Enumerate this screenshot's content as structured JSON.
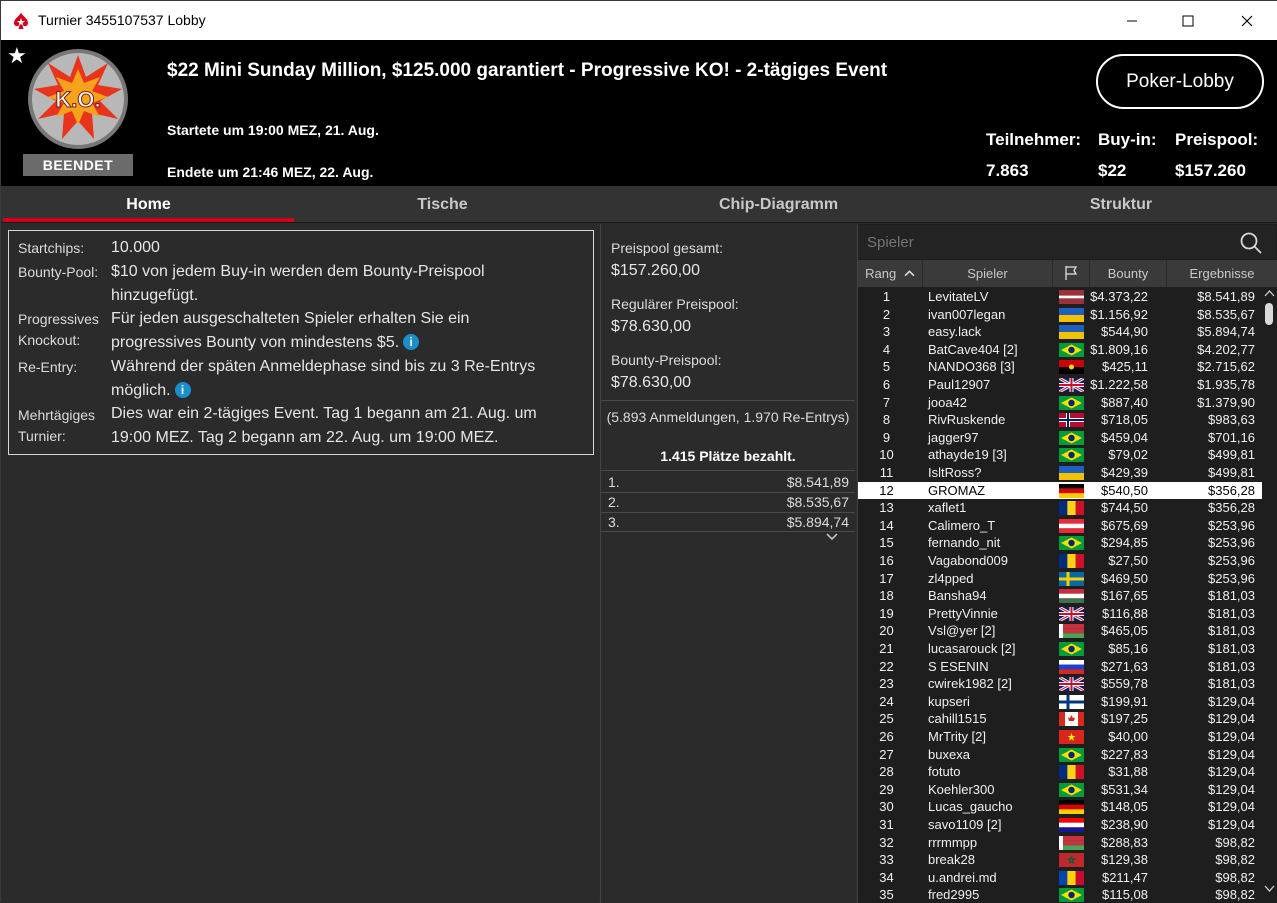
{
  "window": {
    "title": "Turnier 3455107537 Lobby"
  },
  "header": {
    "status": "BEENDET",
    "event_title": "$22 Mini Sunday Million, $125.000 garantiert - Progressive KO! - 2-tägiges Event",
    "started": "Startete um 19:00 MEZ, 21. Aug.",
    "ended": "Endete um 21:46 MEZ, 22. Aug.",
    "lobby_button": "Poker-Lobby",
    "logo_text": "K.O.",
    "stats": [
      {
        "label": "Teilnehmer:",
        "value": "7.863"
      },
      {
        "label": "Buy-in:",
        "value": "$22"
      },
      {
        "label": "Preispool:",
        "value": "$157.260"
      }
    ]
  },
  "tabs": [
    {
      "label": "Home",
      "active": true
    },
    {
      "label": "Tische",
      "active": false
    },
    {
      "label": "Chip-Diagramm",
      "active": false
    },
    {
      "label": "Struktur",
      "active": false
    }
  ],
  "info": [
    {
      "label": "Startchips:",
      "value": "10.000"
    },
    {
      "label": "Bounty-Pool:",
      "value": "$10 von jedem Buy-in werden dem Bounty-Preispool hinzugefügt."
    },
    {
      "label": "Progressives Knockout:",
      "value": "Für jeden ausgeschalteten Spieler erhalten Sie ein progressives Bounty von mindestens $5."
    },
    {
      "label": "Re-Entry:",
      "value": "Während der späten Anmeldephase sind bis zu 3 Re-Entrys möglich."
    },
    {
      "label": "Mehrtägiges Turnier:",
      "value": "Dies war ein 2-tägiges Event. Tag 1 begann am 21. Aug. um 19:00 MEZ. Tag 2 begann am 22. Aug. um 19:00 MEZ."
    }
  ],
  "prizepool": {
    "total_label": "Preispool gesamt:",
    "total": "$157.260,00",
    "regular_label": "Regulärer Preispool:",
    "regular": "$78.630,00",
    "bounty_label": "Bounty-Preispool:",
    "bounty": "$78.630,00",
    "registrations": "(5.893 Anmeldungen, 1.970 Re-Entrys)",
    "paid": "1.415 Plätze bezahlt.",
    "payouts": [
      {
        "rank": "1.",
        "amount": "$8.541,89"
      },
      {
        "rank": "2.",
        "amount": "$8.535,67"
      },
      {
        "rank": "3.",
        "amount": "$5.894,74"
      }
    ]
  },
  "players": {
    "search_placeholder": "Spieler",
    "columns": {
      "rank": "Rang",
      "player": "Spieler",
      "bounty": "Bounty",
      "result": "Ergebnisse"
    },
    "highlighted_rank": "12",
    "rows": [
      {
        "rank": "1",
        "name": "LevitateLV",
        "flag": "lv",
        "bounty": "$4.373,22",
        "result": "$8.541,89"
      },
      {
        "rank": "2",
        "name": "ivan007legan",
        "flag": "ua",
        "bounty": "$1.156,92",
        "result": "$8.535,67"
      },
      {
        "rank": "3",
        "name": "easy.lack",
        "flag": "ua",
        "bounty": "$544,90",
        "result": "$5.894,74"
      },
      {
        "rank": "4",
        "name": "BatCave404 [2]",
        "flag": "br",
        "bounty": "$1.809,16",
        "result": "$4.202,77"
      },
      {
        "rank": "5",
        "name": "NANDO368 [3]",
        "flag": "ao",
        "bounty": "$425,11",
        "result": "$2.715,62"
      },
      {
        "rank": "6",
        "name": "Paul12907",
        "flag": "gb",
        "bounty": "$1.222,58",
        "result": "$1.935,78"
      },
      {
        "rank": "7",
        "name": "jooa42",
        "flag": "br",
        "bounty": "$887,40",
        "result": "$1.379,90"
      },
      {
        "rank": "8",
        "name": "RivRuskende",
        "flag": "no",
        "bounty": "$718,05",
        "result": "$983,63"
      },
      {
        "rank": "9",
        "name": "jagger97",
        "flag": "br",
        "bounty": "$459,04",
        "result": "$701,16"
      },
      {
        "rank": "10",
        "name": "athayde19 [3]",
        "flag": "br",
        "bounty": "$79,02",
        "result": "$499,81"
      },
      {
        "rank": "11",
        "name": "IsltRoss?",
        "flag": "ua",
        "bounty": "$429,39",
        "result": "$499,81"
      },
      {
        "rank": "12",
        "name": "GROMAZ",
        "flag": "de",
        "bounty": "$540,50",
        "result": "$356,28"
      },
      {
        "rank": "13",
        "name": "xaflet1",
        "flag": "ro",
        "bounty": "$744,50",
        "result": "$356,28"
      },
      {
        "rank": "14",
        "name": "Calimero_T",
        "flag": "at",
        "bounty": "$675,69",
        "result": "$253,96"
      },
      {
        "rank": "15",
        "name": "fernando_nit",
        "flag": "br",
        "bounty": "$294,85",
        "result": "$253,96"
      },
      {
        "rank": "16",
        "name": "Vagabond009",
        "flag": "ro",
        "bounty": "$27,50",
        "result": "$253,96"
      },
      {
        "rank": "17",
        "name": "zl4pped",
        "flag": "se",
        "bounty": "$469,50",
        "result": "$253,96"
      },
      {
        "rank": "18",
        "name": "Bansha94",
        "flag": "hu",
        "bounty": "$167,65",
        "result": "$181,03"
      },
      {
        "rank": "19",
        "name": "PrettyVinnie",
        "flag": "gb",
        "bounty": "$116,88",
        "result": "$181,03"
      },
      {
        "rank": "20",
        "name": "Vsl@yer [2]",
        "flag": "by",
        "bounty": "$465,05",
        "result": "$181,03"
      },
      {
        "rank": "21",
        "name": "lucasarouck [2]",
        "flag": "br",
        "bounty": "$85,16",
        "result": "$181,03"
      },
      {
        "rank": "22",
        "name": "S ESENIN",
        "flag": "ru",
        "bounty": "$271,63",
        "result": "$181,03"
      },
      {
        "rank": "23",
        "name": "cwirek1982 [2]",
        "flag": "gb",
        "bounty": "$559,78",
        "result": "$181,03"
      },
      {
        "rank": "24",
        "name": "kupseri",
        "flag": "fi",
        "bounty": "$199,91",
        "result": "$129,04"
      },
      {
        "rank": "25",
        "name": "cahill1515",
        "flag": "ca",
        "bounty": "$197,25",
        "result": "$129,04"
      },
      {
        "rank": "26",
        "name": "MrTrity [2]",
        "flag": "vn",
        "bounty": "$40,00",
        "result": "$129,04"
      },
      {
        "rank": "27",
        "name": "buxexa",
        "flag": "br",
        "bounty": "$227,83",
        "result": "$129,04"
      },
      {
        "rank": "28",
        "name": "fotuto",
        "flag": "ro",
        "bounty": "$31,88",
        "result": "$129,04"
      },
      {
        "rank": "29",
        "name": "Koehler300",
        "flag": "br",
        "bounty": "$531,34",
        "result": "$129,04"
      },
      {
        "rank": "30",
        "name": "Lucas_gaucho",
        "flag": "de",
        "bounty": "$148,05",
        "result": "$129,04"
      },
      {
        "rank": "31",
        "name": "savo1109 [2]",
        "flag": "hr",
        "bounty": "$238,90",
        "result": "$129,04"
      },
      {
        "rank": "32",
        "name": "rrrmmpp",
        "flag": "by",
        "bounty": "$288,83",
        "result": "$98,82"
      },
      {
        "rank": "33",
        "name": "break28",
        "flag": "ma",
        "bounty": "$129,38",
        "result": "$98,82"
      },
      {
        "rank": "34",
        "name": "u.andrei.md",
        "flag": "md",
        "bounty": "$211,47",
        "result": "$98,82"
      },
      {
        "rank": "35",
        "name": "fred2995",
        "flag": "br",
        "bounty": "$115,08",
        "result": "$98,82"
      }
    ]
  },
  "colors": {
    "accent": "#d0021b",
    "info_icon": "#1b8ecc",
    "header_bg": "#000000"
  }
}
